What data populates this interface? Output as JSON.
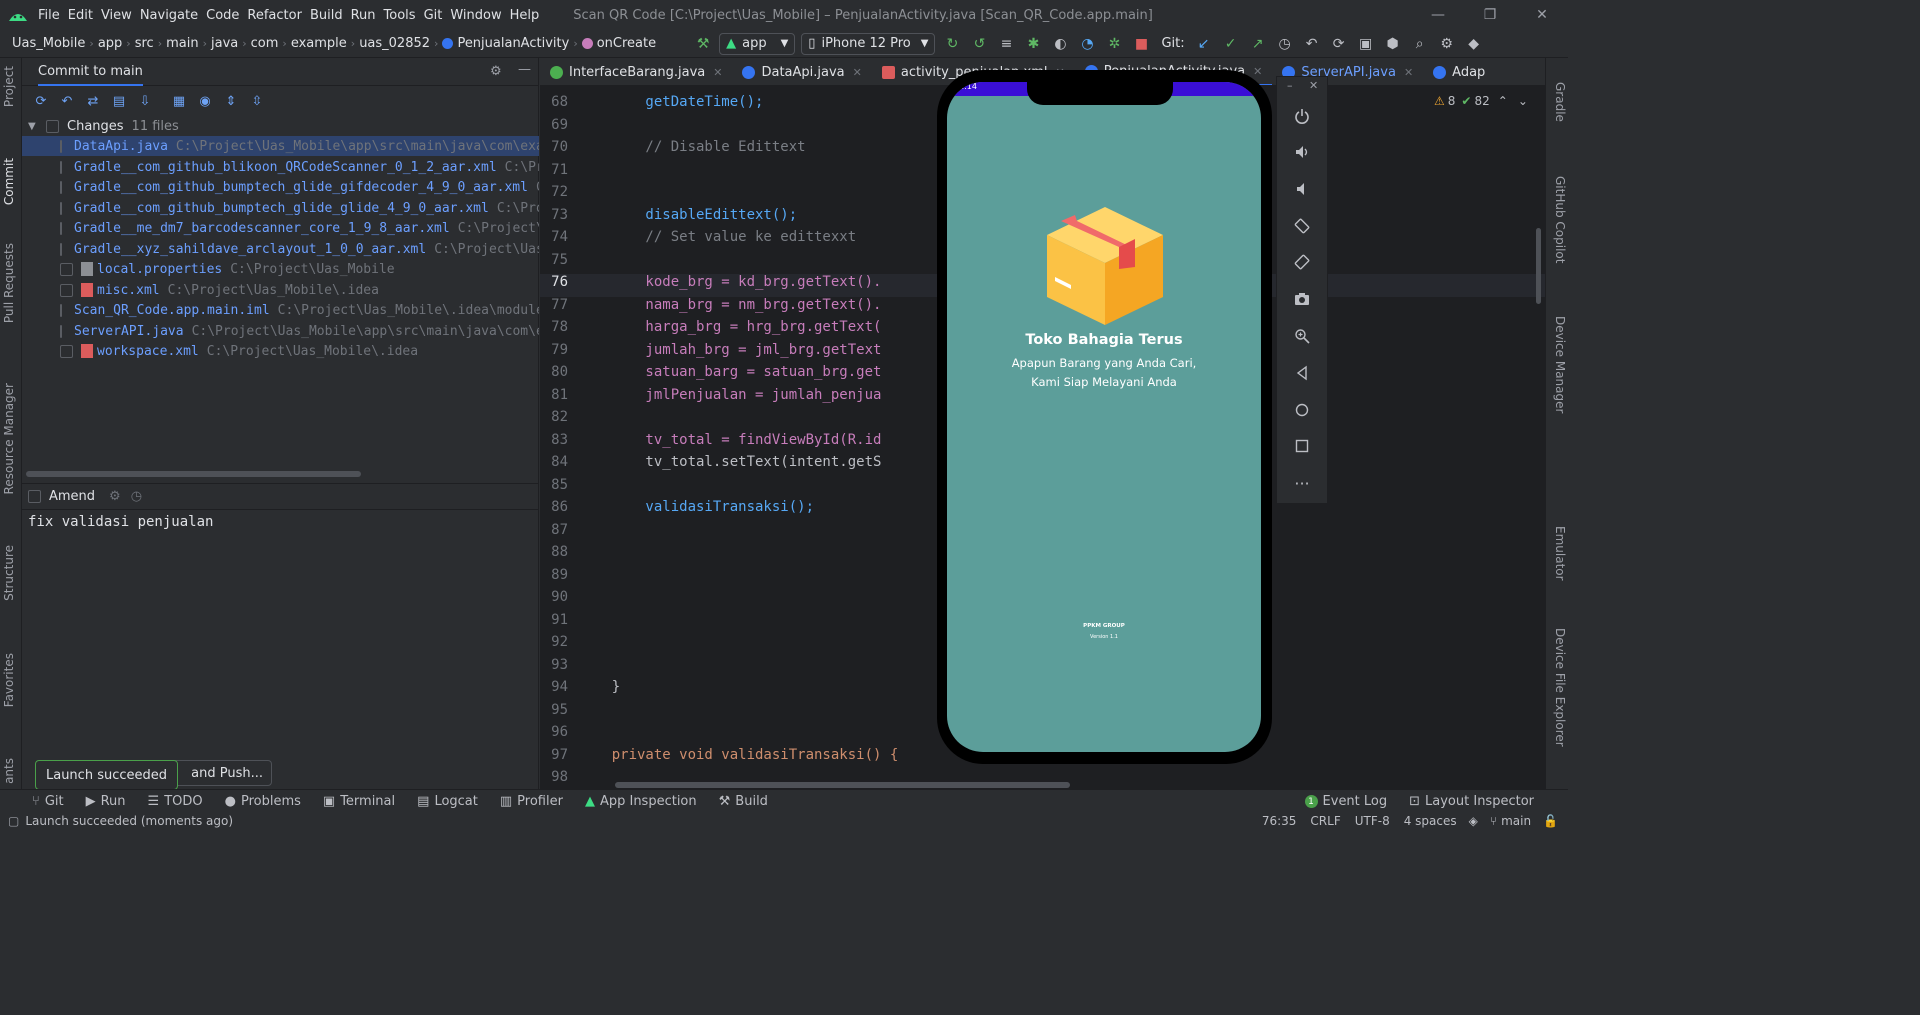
{
  "window": {
    "menu": [
      "File",
      "Edit",
      "View",
      "Navigate",
      "Code",
      "Refactor",
      "Build",
      "Run",
      "Tools",
      "Git",
      "Window",
      "Help"
    ],
    "title": "Scan QR Code [C:\\Project\\Uas_Mobile] – PenjualanActivity.java [Scan_QR_Code.app.main]"
  },
  "navbar": {
    "breadcrumbs": [
      "Uas_Mobile",
      "app",
      "src",
      "main",
      "java",
      "com",
      "example",
      "uas_02852",
      "PenjualanActivity",
      "onCreate"
    ],
    "run_config": "app",
    "device": "iPhone 12 Pro",
    "git_label": "Git:"
  },
  "left_strip": [
    "Project",
    "Commit",
    "Pull Requests",
    "Resource Manager",
    "Structure",
    "Favorites",
    "ants"
  ],
  "right_strip": [
    "Gradle",
    "GitHub Copilot",
    "Device Manager",
    "Emulator",
    "Device File Explorer"
  ],
  "commit_panel": {
    "header": "Commit to main",
    "changes_label": "Changes",
    "changes_count": "11 files",
    "files": [
      {
        "name": "DataApi.java",
        "path": "C:\\Project\\Uas_Mobile\\app\\src\\main\\java\\com\\exa"
      },
      {
        "name": "Gradle__com_github_blikoon_QRCodeScanner_0_1_2_aar.xml",
        "path": "C:\\Pr"
      },
      {
        "name": "Gradle__com_github_bumptech_glide_gifdecoder_4_9_0_aar.xml",
        "path": "C"
      },
      {
        "name": "Gradle__com_github_bumptech_glide_glide_4_9_0_aar.xml",
        "path": "C:\\Pro"
      },
      {
        "name": "Gradle__me_dm7_barcodescanner_core_1_9_8_aar.xml",
        "path": "C:\\Project\\"
      },
      {
        "name": "Gradle__xyz_sahildave_arclayout_1_0_0_aar.xml",
        "path": "C:\\Project\\Uas"
      },
      {
        "name": "local.properties",
        "path": "C:\\Project\\Uas_Mobile"
      },
      {
        "name": "misc.xml",
        "path": "C:\\Project\\Uas_Mobile\\.idea"
      },
      {
        "name": "Scan_QR_Code.app.main.iml",
        "path": "C:\\Project\\Uas_Mobile\\.idea\\module"
      },
      {
        "name": "ServerAPI.java",
        "path": "C:\\Project\\Uas_Mobile\\app\\src\\main\\java\\com\\e"
      },
      {
        "name": "workspace.xml",
        "path": "C:\\Project\\Uas_Mobile\\.idea"
      }
    ],
    "amend_label": "Amend",
    "commit_message": "fix validasi penjualan",
    "push_button": "and Push..."
  },
  "editor": {
    "tabs": [
      "InterfaceBarang.java",
      "DataApi.java",
      "activity_penjualan.xml",
      "PenjualanActivity.java",
      "ServerAPI.java",
      "Adap"
    ],
    "warnings": "8",
    "checks": "82",
    "lines": [
      {
        "n": "68",
        "t": "        getDateTime();"
      },
      {
        "n": "69",
        "t": ""
      },
      {
        "n": "70",
        "t": "        // Disable Edittext"
      },
      {
        "n": "71",
        "t": ""
      },
      {
        "n": "72",
        "t": ""
      },
      {
        "n": "73",
        "t": "        disableEdittext();"
      },
      {
        "n": "74",
        "t": "        // Set value ke edittexxt"
      },
      {
        "n": "75",
        "t": ""
      },
      {
        "n": "76",
        "t": "        kode_brg = kd_brg.getText()."
      },
      {
        "n": "77",
        "t": "        nama_brg = nm_brg.getText()."
      },
      {
        "n": "78",
        "t": "        harga_brg = hrg_brg.getText("
      },
      {
        "n": "79",
        "t": "        jumlah_brg = jml_brg.getText"
      },
      {
        "n": "80",
        "t": "        satuan_barg = satuan_brg.get"
      },
      {
        "n": "81",
        "t": "        jmlPenjualan = jumlah_penjua"
      },
      {
        "n": "82",
        "t": ""
      },
      {
        "n": "83",
        "t": "        tv_total = findViewById(R.id"
      },
      {
        "n": "84",
        "t": "        tv_total.setText(intent.getS"
      },
      {
        "n": "85",
        "t": ""
      },
      {
        "n": "86",
        "t": "        validasiTransaksi();"
      },
      {
        "n": "87",
        "t": ""
      },
      {
        "n": "88",
        "t": ""
      },
      {
        "n": "89",
        "t": ""
      },
      {
        "n": "90",
        "t": ""
      },
      {
        "n": "91",
        "t": ""
      },
      {
        "n": "92",
        "t": ""
      },
      {
        "n": "93",
        "t": ""
      },
      {
        "n": "94",
        "t": "    }"
      },
      {
        "n": "95",
        "t": ""
      },
      {
        "n": "96",
        "t": ""
      },
      {
        "n": "97",
        "t": "    private void validasiTransaksi() {"
      },
      {
        "n": "98",
        "t": ""
      }
    ]
  },
  "phone": {
    "status_time": "1:14",
    "store_name": "Toko Bahagia Terus",
    "tagline_1": "Apapun Barang yang Anda Cari,",
    "tagline_2": "Kami Siap Melayani Anda",
    "group": "PPKM GROUP",
    "version": "Version 1.1",
    "bg_color": "#5c9e9a"
  },
  "toast": "Launch succeeded",
  "bottom_tools": [
    "Git",
    "Run",
    "TODO",
    "Problems",
    "Terminal",
    "Logcat",
    "Profiler",
    "App Inspection",
    "Build"
  ],
  "bottom_right": [
    "Event Log",
    "Layout Inspector"
  ],
  "event_count": "1",
  "status": {
    "message": "Launch succeeded (moments ago)",
    "position": "76:35",
    "line_sep": "CRLF",
    "encoding": "UTF-8",
    "indent": "4 spaces",
    "branch": "main"
  }
}
